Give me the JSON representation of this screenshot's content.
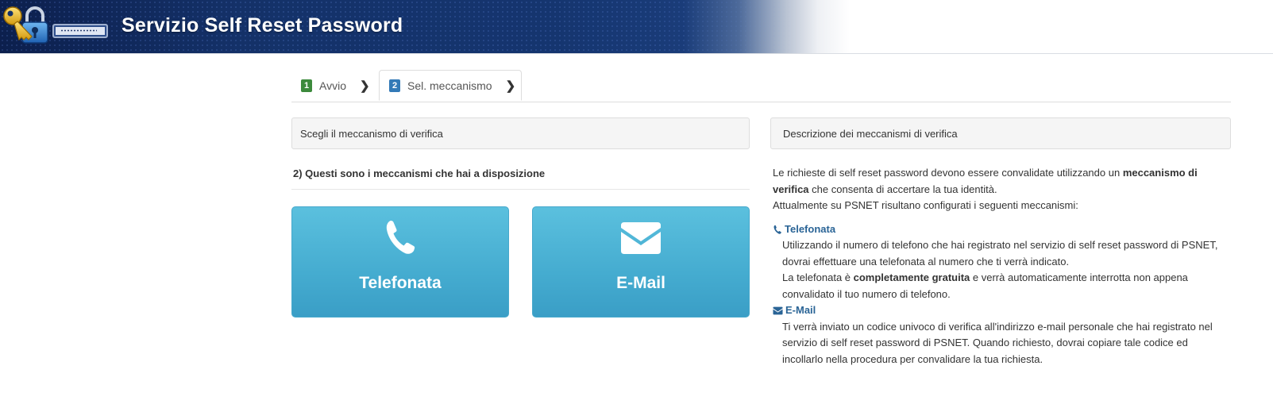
{
  "header": {
    "title": "Servizio Self Reset Password",
    "logo_icon": "key-lock-icon",
    "field_icon": "password-field-icon",
    "colors": {
      "banner_dark": "#0c1f4d",
      "banner_mid": "#15356f"
    }
  },
  "wizard": {
    "steps": [
      {
        "number": "1",
        "label": "Avvio",
        "badge_color": "#3c8a3c"
      },
      {
        "number": "2",
        "label": "Sel. meccanismo",
        "badge_color": "#337ab7",
        "active": true
      }
    ]
  },
  "left_panel": {
    "heading": "Scegli il meccanismo di verifica",
    "subtitle": "2) Questi sono i meccanismi che hai a disposizione",
    "buttons": [
      {
        "label": "Telefonata",
        "icon": "phone-icon"
      },
      {
        "label": "E-Mail",
        "icon": "envelope-icon"
      }
    ],
    "button_color": "#5bc0de"
  },
  "right_panel": {
    "heading": "Descrizione dei meccanismi di verifica",
    "intro_pre": "Le richieste di self reset password devono essere convalidate utilizzando un ",
    "intro_bold": "meccanismo di verifica",
    "intro_post": " che consenta di accertare la tua identità.",
    "intro_line2": "Attualmente su PSNET risultano configurati i seguenti meccanismi:",
    "mechanisms": {
      "phone": {
        "title": "Telefonata",
        "icon": "phone-icon",
        "text1": "Utilizzando il numero di telefono che hai registrato nel servizio di self reset password di PSNET, dovrai effettuare una telefonata al numero che ti verrà indicato.",
        "text2_pre": "La telefonata è ",
        "text2_bold": "completamente gratuita",
        "text2_post": " e verrà automaticamente interrotta non appena convalidato il tuo numero di telefono."
      },
      "email": {
        "title": "E-Mail",
        "icon": "envelope-icon",
        "text": "Ti verrà inviato un codice univoco di verifica all'indirizzo e-mail personale che hai registrato nel servizio di self reset password di PSNET. Quando richiesto, dovrai copiare tale codice ed incollarlo nella procedura per convalidare la tua richiesta."
      }
    },
    "title_color": "#2a6496"
  }
}
